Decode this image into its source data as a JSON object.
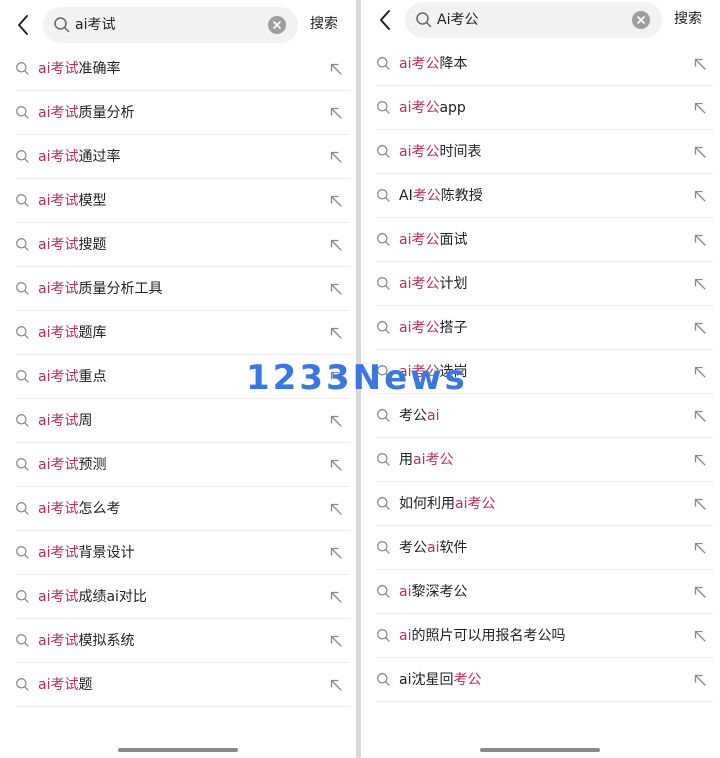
{
  "watermark": "1233News",
  "left": {
    "query": "ai考试",
    "search_label": "搜索",
    "suggestions": [
      {
        "hl": "ai考试",
        "rest": "准确率"
      },
      {
        "hl": "ai考试",
        "rest": "质量分析"
      },
      {
        "hl": "ai考试",
        "rest": "通过率"
      },
      {
        "hl": "ai考试",
        "rest": "模型"
      },
      {
        "hl": "ai考试",
        "rest": "搜题"
      },
      {
        "hl": "ai考试",
        "rest": "质量分析工具"
      },
      {
        "hl": "ai考试",
        "rest": "题库"
      },
      {
        "hl": "ai考试",
        "rest": "重点"
      },
      {
        "hl": "ai考试",
        "rest": "周"
      },
      {
        "hl": "ai考试",
        "rest": "预测"
      },
      {
        "hl": "ai考试",
        "rest": "怎么考"
      },
      {
        "hl": "ai考试",
        "rest": "背景设计"
      },
      {
        "hl": "ai考试",
        "rest": "成绩ai对比"
      },
      {
        "hl": "ai考试",
        "rest": "模拟系统"
      },
      {
        "hl": "ai考试",
        "rest": "题"
      }
    ]
  },
  "right": {
    "query": "Ai考公",
    "search_label": "搜索",
    "suggestions": [
      {
        "pre": "",
        "hl": "ai考公",
        "post": "降本"
      },
      {
        "pre": "",
        "hl": "ai考公",
        "post": "app"
      },
      {
        "pre": "",
        "hl": "ai考公",
        "post": "时间表"
      },
      {
        "pre": "AI",
        "hl": "考公",
        "post": "陈教授"
      },
      {
        "pre": "",
        "hl": "ai考公",
        "post": "面试"
      },
      {
        "pre": "",
        "hl": "ai考公",
        "post": "计划"
      },
      {
        "pre": "",
        "hl": "ai考公",
        "post": "搭子"
      },
      {
        "pre": "",
        "hl": "ai考公",
        "post": "选岗"
      },
      {
        "pre": "考公",
        "hl": "ai",
        "post": ""
      },
      {
        "pre": "用",
        "hl": "ai考公",
        "post": ""
      },
      {
        "pre": "如何利用",
        "hl": "ai考公",
        "post": ""
      },
      {
        "pre": "考公",
        "hl": "ai",
        "post": "软件"
      },
      {
        "pre": "",
        "hl": "ai",
        "post": "黎深考公"
      },
      {
        "pre": "",
        "hl": "ai",
        "post": "的照片可以用报名考公吗"
      },
      {
        "pre": "ai沈星回",
        "hl": "考公",
        "post": ""
      }
    ]
  },
  "colors": {
    "highlight": "#b5325a",
    "watermark": "#3a78e0",
    "text": "#222222",
    "searchbox_bg": "#f2f2f2"
  }
}
